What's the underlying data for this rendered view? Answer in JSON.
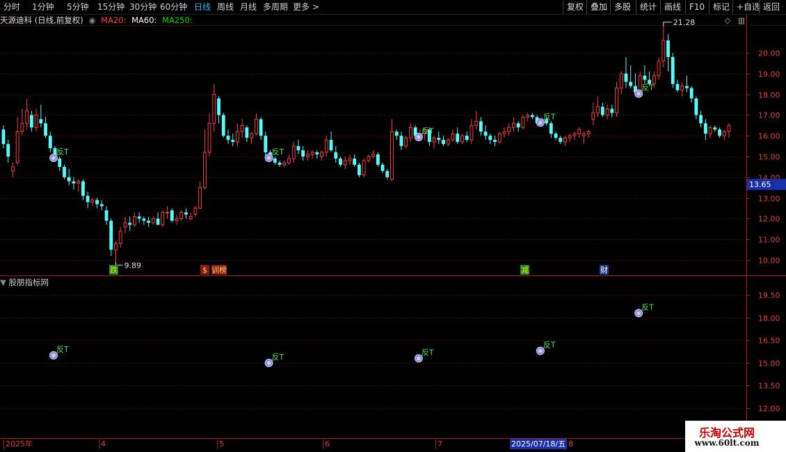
{
  "toolbar": {
    "periods": [
      "分时",
      "1分钟",
      "5分钟",
      "15分钟",
      "30分钟",
      "60分钟",
      "日线",
      "周线",
      "月线",
      "多周期",
      "更多 >"
    ],
    "active_period": "日线",
    "right_buttons": [
      "复权",
      "叠加",
      "多股",
      "统计",
      "画线",
      "F10",
      "标记",
      "+自选",
      "返回"
    ]
  },
  "main": {
    "stock_title": "天源迪科 (日线,前复权)",
    "ma20": "MA20:",
    "ma60": "MA60:",
    "ma250": "MA250:",
    "price_labels": [
      "20.00",
      "19.00",
      "18.00",
      "17.00",
      "16.00",
      "15.00",
      "14.00",
      "13.00",
      "12.00",
      "11.00",
      "10.00"
    ],
    "current_price": "13.65",
    "high_label": "21.28",
    "low_label": "9.89",
    "event_badges": [
      "跌",
      "$",
      "训榜",
      "减",
      "财"
    ],
    "signal_label": "反T"
  },
  "sub": {
    "indicator_title": "股朋指标网",
    "price_labels": [
      "19.50",
      "18.00",
      "16.50",
      "15.00",
      "13.50",
      "12.00"
    ]
  },
  "date_axis": {
    "labels": [
      "2025年",
      "4",
      "5",
      "6",
      "7",
      "8"
    ],
    "cursor_date": "2025/07/18/五"
  },
  "watermark": {
    "title": "乐淘公式网",
    "url": "www.60lt.com"
  },
  "colors": {
    "up": "#ff3c3c",
    "down": "#54fcfc",
    "grid": "#7a1010",
    "ma20": "#ff4040",
    "ma60": "#ffffff",
    "ma250": "#00e000",
    "active_tab": "#29b6f6"
  },
  "chart_data": {
    "type": "candlestick",
    "price_axis_range": [
      9.5,
      21.6
    ],
    "ohlc": [
      [
        16.3,
        16.5,
        15.4,
        15.6
      ],
      [
        15.6,
        15.8,
        14.7,
        15.0
      ],
      [
        14.3,
        14.7,
        14.0,
        14.5
      ],
      [
        14.7,
        16.9,
        14.6,
        16.2
      ],
      [
        16.2,
        17.3,
        16.0,
        16.6
      ],
      [
        16.6,
        17.8,
        16.3,
        17.2
      ],
      [
        17.0,
        17.2,
        16.2,
        16.4
      ],
      [
        16.4,
        17.3,
        16.2,
        17.0
      ],
      [
        16.8,
        17.5,
        16.4,
        16.6
      ],
      [
        16.6,
        16.9,
        15.9,
        16.0
      ],
      [
        16.0,
        16.2,
        15.2,
        15.4
      ],
      [
        15.4,
        15.5,
        14.8,
        14.9
      ],
      [
        14.9,
        15.0,
        14.3,
        14.5
      ],
      [
        14.5,
        14.6,
        13.9,
        14.0
      ],
      [
        14.0,
        14.4,
        13.6,
        13.8
      ],
      [
        13.8,
        14.0,
        13.4,
        13.7
      ],
      [
        13.7,
        13.9,
        13.3,
        13.8
      ],
      [
        13.8,
        13.9,
        12.9,
        13.1
      ],
      [
        13.1,
        13.3,
        12.5,
        12.8
      ],
      [
        12.8,
        13.0,
        12.6,
        12.9
      ],
      [
        12.9,
        13.0,
        12.5,
        12.7
      ],
      [
        12.7,
        12.9,
        12.4,
        12.6
      ],
      [
        12.4,
        12.6,
        11.7,
        11.9
      ],
      [
        11.9,
        12.0,
        10.2,
        10.5
      ],
      [
        10.5,
        10.9,
        9.89,
        10.8
      ],
      [
        10.8,
        11.6,
        10.6,
        11.4
      ],
      [
        11.6,
        12.1,
        11.3,
        11.8
      ],
      [
        11.8,
        12.1,
        11.4,
        11.7
      ],
      [
        11.7,
        12.3,
        11.6,
        12.1
      ],
      [
        12.1,
        12.3,
        11.8,
        12.0
      ],
      [
        12.0,
        12.1,
        11.7,
        11.9
      ],
      [
        11.9,
        12.1,
        11.6,
        11.8
      ],
      [
        11.8,
        12.1,
        11.7,
        12.0
      ],
      [
        12.0,
        12.3,
        11.8,
        11.7
      ],
      [
        11.7,
        12.4,
        11.6,
        12.3
      ],
      [
        12.3,
        12.6,
        12.0,
        12.3
      ],
      [
        12.4,
        12.5,
        11.8,
        11.9
      ],
      [
        11.9,
        12.2,
        11.7,
        12.0
      ],
      [
        12.0,
        12.4,
        11.9,
        12.3
      ],
      [
        12.3,
        12.5,
        12.0,
        12.2
      ],
      [
        12.0,
        12.3,
        11.9,
        12.1
      ],
      [
        12.2,
        12.6,
        12.1,
        12.5
      ],
      [
        12.5,
        13.8,
        12.5,
        13.5
      ],
      [
        13.5,
        16.3,
        13.4,
        15.2
      ],
      [
        15.2,
        17.1,
        15.0,
        16.6
      ],
      [
        16.6,
        18.5,
        16.2,
        18.0
      ],
      [
        17.8,
        17.9,
        16.6,
        17.0
      ],
      [
        17.0,
        17.1,
        15.9,
        16.0
      ],
      [
        16.0,
        16.3,
        15.6,
        15.8
      ],
      [
        15.8,
        16.1,
        15.5,
        15.7
      ],
      [
        15.7,
        16.6,
        15.5,
        16.2
      ],
      [
        16.2,
        16.8,
        15.9,
        16.5
      ],
      [
        16.4,
        16.5,
        15.7,
        15.9
      ],
      [
        15.9,
        16.2,
        15.6,
        16.1
      ],
      [
        16.1,
        17.1,
        16.0,
        16.8
      ],
      [
        16.8,
        16.9,
        15.8,
        16.0
      ],
      [
        16.0,
        16.2,
        15.0,
        15.2
      ],
      [
        15.2,
        15.3,
        14.8,
        14.9
      ],
      [
        14.9,
        15.0,
        14.6,
        14.7
      ],
      [
        14.7,
        14.8,
        14.5,
        14.6
      ],
      [
        14.6,
        14.8,
        14.5,
        14.7
      ],
      [
        14.7,
        15.1,
        14.6,
        14.9
      ],
      [
        14.9,
        15.7,
        14.7,
        15.5
      ],
      [
        15.5,
        15.8,
        15.1,
        15.3
      ],
      [
        15.3,
        15.5,
        14.8,
        15.0
      ],
      [
        15.0,
        15.3,
        14.8,
        15.1
      ],
      [
        15.1,
        15.3,
        14.9,
        15.2
      ],
      [
        15.2,
        15.3,
        14.9,
        15.1
      ],
      [
        15.0,
        15.3,
        14.8,
        15.2
      ],
      [
        15.2,
        16.0,
        15.0,
        15.8
      ],
      [
        15.8,
        16.2,
        15.2,
        15.3
      ],
      [
        15.2,
        15.5,
        14.7,
        14.9
      ],
      [
        14.9,
        15.0,
        14.5,
        14.6
      ],
      [
        14.6,
        15.0,
        14.4,
        14.8
      ],
      [
        14.8,
        15.1,
        14.6,
        14.9
      ],
      [
        14.9,
        15.1,
        14.5,
        14.6
      ],
      [
        14.6,
        14.7,
        14.0,
        14.1
      ],
      [
        14.1,
        14.9,
        14.0,
        14.8
      ],
      [
        14.8,
        15.1,
        14.7,
        15.0
      ],
      [
        15.0,
        15.3,
        14.9,
        15.1
      ],
      [
        15.1,
        15.2,
        14.5,
        14.6
      ],
      [
        14.6,
        14.7,
        14.2,
        14.3
      ],
      [
        14.3,
        14.4,
        13.9,
        14.0
      ],
      [
        13.9,
        16.8,
        13.8,
        16.2
      ],
      [
        16.2,
        16.3,
        15.8,
        16.0
      ],
      [
        16.0,
        16.2,
        15.3,
        15.5
      ],
      [
        15.5,
        16.0,
        15.4,
        15.9
      ],
      [
        15.9,
        16.6,
        15.7,
        16.4
      ],
      [
        16.4,
        16.5,
        15.9,
        16.0
      ],
      [
        16.0,
        16.3,
        15.8,
        16.1
      ],
      [
        16.1,
        16.4,
        15.8,
        16.3
      ],
      [
        16.3,
        16.4,
        15.5,
        15.7
      ],
      [
        15.7,
        16.0,
        15.4,
        15.9
      ],
      [
        15.9,
        16.2,
        15.6,
        15.8
      ],
      [
        15.8,
        16.0,
        15.5,
        15.6
      ],
      [
        15.6,
        15.9,
        15.5,
        15.8
      ],
      [
        15.8,
        16.3,
        15.7,
        16.1
      ],
      [
        16.1,
        16.4,
        15.6,
        15.7
      ],
      [
        15.7,
        16.1,
        15.6,
        16.0
      ],
      [
        16.0,
        16.2,
        15.7,
        15.8
      ],
      [
        15.8,
        16.8,
        15.6,
        16.5
      ],
      [
        16.5,
        17.2,
        16.3,
        16.7
      ],
      [
        16.7,
        16.9,
        16.0,
        16.2
      ],
      [
        16.2,
        16.5,
        15.8,
        16.0
      ],
      [
        16.0,
        16.1,
        15.6,
        15.8
      ],
      [
        15.8,
        16.0,
        15.5,
        15.7
      ],
      [
        15.7,
        16.2,
        15.6,
        16.1
      ],
      [
        16.1,
        16.4,
        15.9,
        16.2
      ],
      [
        16.2,
        16.6,
        16.0,
        16.4
      ],
      [
        16.4,
        16.9,
        16.2,
        16.6
      ],
      [
        16.6,
        16.7,
        16.2,
        16.4
      ],
      [
        16.4,
        17.0,
        16.3,
        16.9
      ],
      [
        16.9,
        17.1,
        16.7,
        17.0
      ],
      [
        17.0,
        17.1,
        16.8,
        16.9
      ],
      [
        16.9,
        17.0,
        16.5,
        16.6
      ],
      [
        16.6,
        16.9,
        16.5,
        16.8
      ],
      [
        16.8,
        16.9,
        16.5,
        16.6
      ],
      [
        16.6,
        16.7,
        15.9,
        16.1
      ],
      [
        16.1,
        16.2,
        15.8,
        15.9
      ],
      [
        15.9,
        16.0,
        15.6,
        15.7
      ],
      [
        15.7,
        16.0,
        15.5,
        15.9
      ],
      [
        15.9,
        16.1,
        15.7,
        16.0
      ],
      [
        16.0,
        16.2,
        15.8,
        16.1
      ],
      [
        16.1,
        16.4,
        15.9,
        16.3
      ],
      [
        16.0,
        16.2,
        15.6,
        16.1
      ],
      [
        16.1,
        16.3,
        15.9,
        16.2
      ],
      [
        16.8,
        17.6,
        16.5,
        17.1
      ],
      [
        17.1,
        17.9,
        16.9,
        17.4
      ],
      [
        17.4,
        17.6,
        16.9,
        17.0
      ],
      [
        17.0,
        17.5,
        16.8,
        17.3
      ],
      [
        17.3,
        17.5,
        16.9,
        17.1
      ],
      [
        17.1,
        18.6,
        16.9,
        18.3
      ],
      [
        18.3,
        19.1,
        18.0,
        19.0
      ],
      [
        19.0,
        19.8,
        18.3,
        18.6
      ],
      [
        18.6,
        19.4,
        18.3,
        18.4
      ],
      [
        18.4,
        19.0,
        17.9,
        18.1
      ],
      [
        18.1,
        19.1,
        17.9,
        18.9
      ],
      [
        18.9,
        19.4,
        18.5,
        18.7
      ],
      [
        18.7,
        19.1,
        18.4,
        18.5
      ],
      [
        18.5,
        19.1,
        18.3,
        18.9
      ],
      [
        18.9,
        19.8,
        18.7,
        19.6
      ],
      [
        19.6,
        21.28,
        19.3,
        20.6
      ],
      [
        20.6,
        20.9,
        19.1,
        19.8
      ],
      [
        19.8,
        20.0,
        18.3,
        18.5
      ],
      [
        18.5,
        18.7,
        18.1,
        18.2
      ],
      [
        18.2,
        18.6,
        17.9,
        18.4
      ],
      [
        18.4,
        18.9,
        18.1,
        18.3
      ],
      [
        18.3,
        18.4,
        17.6,
        17.8
      ],
      [
        17.8,
        17.9,
        16.8,
        17.0
      ],
      [
        17.0,
        17.2,
        16.4,
        16.6
      ],
      [
        16.6,
        16.8,
        15.8,
        16.1
      ],
      [
        16.1,
        16.5,
        15.9,
        16.4
      ],
      [
        16.4,
        16.5,
        16.2,
        16.3
      ],
      [
        16.3,
        16.4,
        15.9,
        16.0
      ],
      [
        16.0,
        16.3,
        15.8,
        16.2
      ],
      [
        16.2,
        16.6,
        15.9,
        16.5
      ]
    ],
    "signals_main_index": [
      11,
      57,
      89,
      115,
      136
    ],
    "signals_sub": [
      {
        "value": 15.5
      },
      {
        "value": 15.0
      },
      {
        "value": 15.3
      },
      {
        "value": 15.8
      },
      {
        "value": 18.3
      }
    ],
    "sub_axis_range": [
      11.5,
      20.7
    ]
  }
}
